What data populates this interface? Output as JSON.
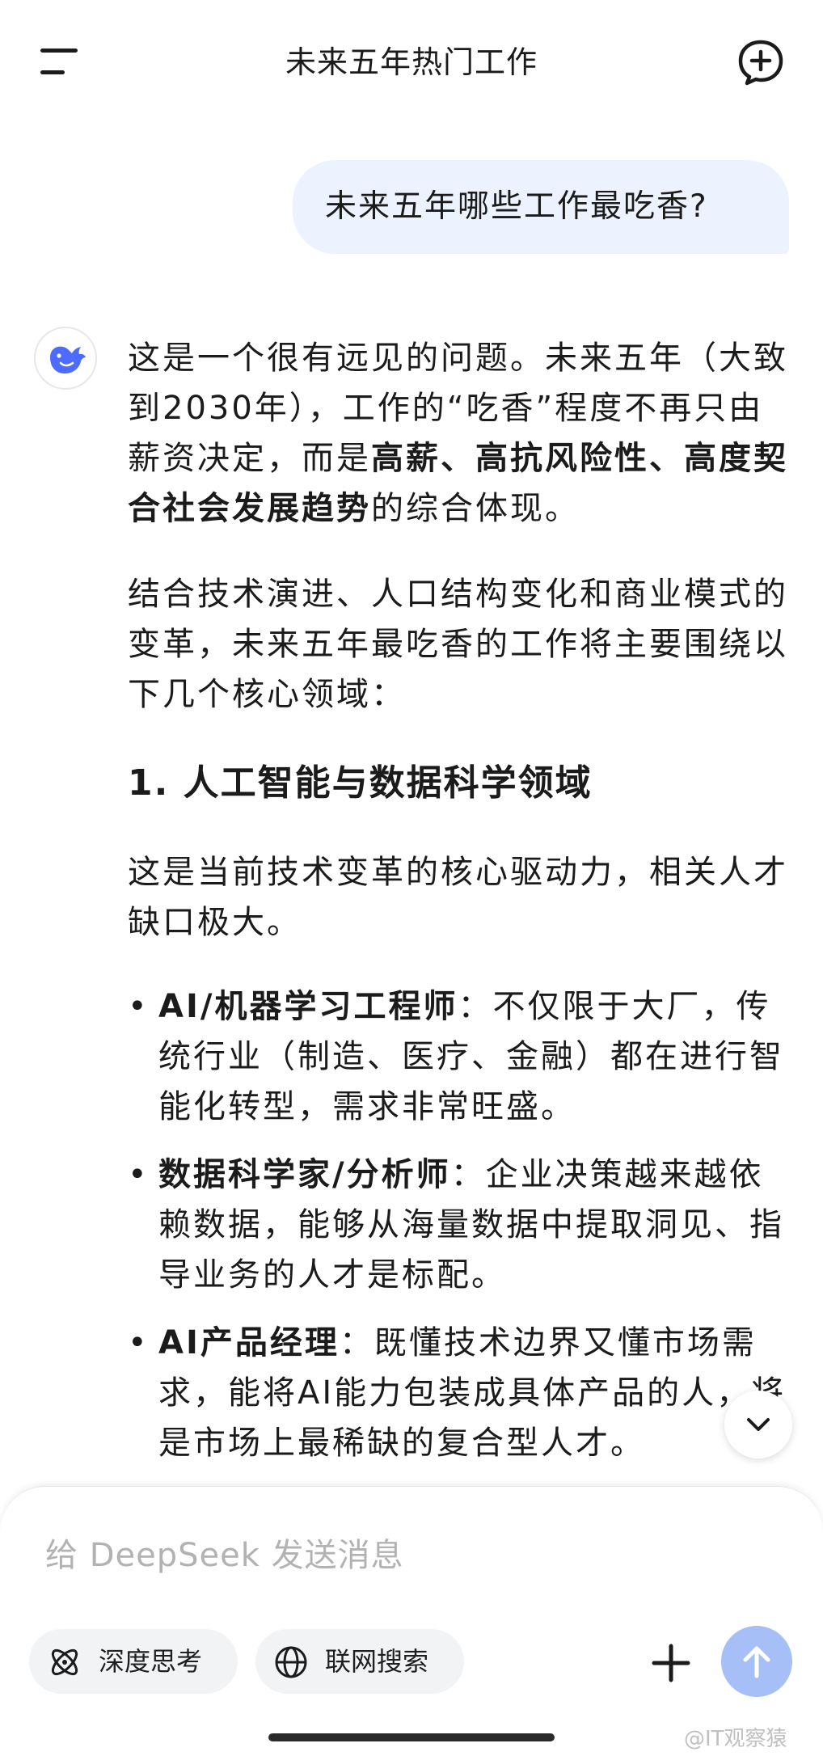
{
  "header": {
    "title": "未来五年热门工作",
    "menu_icon": "menu-icon",
    "new_chat_icon": "new-chat-icon"
  },
  "user_message": "未来五年哪些工作最吃香?",
  "assistant": {
    "avatar_icon": "deepseek-whale-logo",
    "intro_plain_1": "这是一个很有远见的问题。未来五年（大致到2030年），工作的“吃香”程度不再只由薪资决定，而是",
    "intro_bold": "高薪、高抗风险性、高度契合社会发展趋势",
    "intro_plain_2": "的综合体现。",
    "paragraph_2": "结合技术演进、人口结构变化和商业模式的变革，未来五年最吃香的工作将主要围绕以下几个核心领域：",
    "section_1_title": "1. 人工智能与数据科学领域",
    "section_1_desc": "这是当前技术变革的核心驱动力，相关人才缺口极大。",
    "bullets": [
      {
        "title": "AI/机器学习工程师",
        "text": "：不仅限于大厂，传统行业（制造、医疗、金融）都在进行智能化转型，需求非常旺盛。"
      },
      {
        "title": "数据科学家/分析师",
        "text": "：企业决策越来越依赖数据，能够从海量数据中提取洞见、指导业务的人才是标配。"
      },
      {
        "title": "AI产品经理",
        "text": "：既懂技术边界又懂市场需求，能将AI能力包装成具体产品的人，将是市场上最稀缺的复合型人才。"
      }
    ]
  },
  "composer": {
    "placeholder": "给 DeepSeek 发送消息",
    "deep_think_label": "深度思考",
    "web_search_label": "联网搜索"
  },
  "watermark": "@IT观察猿",
  "colors": {
    "user_bubble": "#edf3fe",
    "send_button": "#a6bff7",
    "logo_blue": "#4d6bfe"
  }
}
